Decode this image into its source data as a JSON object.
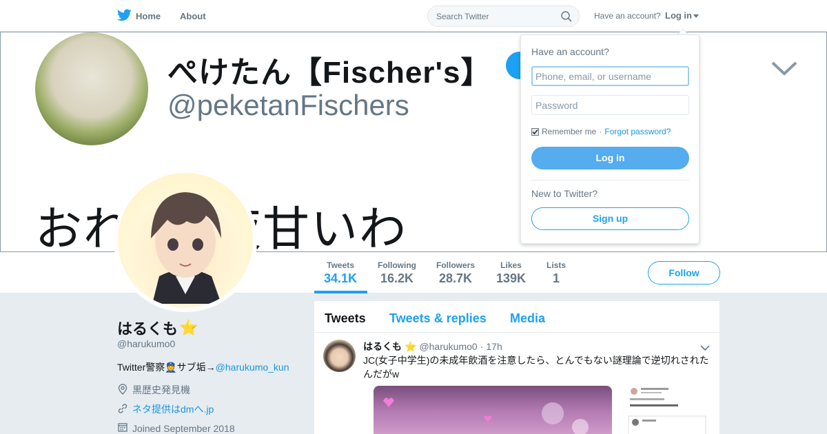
{
  "nav": {
    "home_label": "Home",
    "about_label": "About",
    "search_placeholder": "Search Twitter",
    "have_account": "Have an account?",
    "login_label": "Log in",
    "brand_color": "#1da1f2"
  },
  "banner": {
    "name": "ぺけたん【Fischer's】",
    "handle": "@peketanFischers",
    "caption_left": "おれ",
    "caption_right": "夜甘いわ"
  },
  "stats": [
    {
      "label": "Tweets",
      "value": "34.1K"
    },
    {
      "label": "Following",
      "value": "16.2K"
    },
    {
      "label": "Followers",
      "value": "28.7K"
    },
    {
      "label": "Likes",
      "value": "139K"
    },
    {
      "label": "Lists",
      "value": "1"
    }
  ],
  "follow_label": "Follow",
  "profile": {
    "name": "はるくも",
    "star": "⭐",
    "handle": "@harukumo0",
    "bio_text": "Twitter警察👮サブ垢→",
    "bio_link": "@harukumo_kun",
    "location": "黒歴史発見機",
    "website": "ネタ提供はdmへ.jp",
    "joined": "Joined September 2018"
  },
  "timeline": {
    "tabs": [
      "Tweets",
      "Tweets & replies",
      "Media"
    ],
    "tweet": {
      "name": "はるくも",
      "star": "⭐",
      "handle": "@harukumo0",
      "separator": "·",
      "time": "17h",
      "text": "JC(女子中学生)の未成年飲酒を注意したら、とんでもない謎理論で逆切れされたんだがw"
    }
  },
  "login_dropdown": {
    "title": "Have an account?",
    "username_placeholder": "Phone, email, or username",
    "password_placeholder": "Password",
    "remember": "Remember me",
    "separator": "·",
    "forgot": "Forgot password?",
    "login_button": "Log in",
    "new_to_twitter": "New to Twitter?",
    "signup_button": "Sign up"
  }
}
